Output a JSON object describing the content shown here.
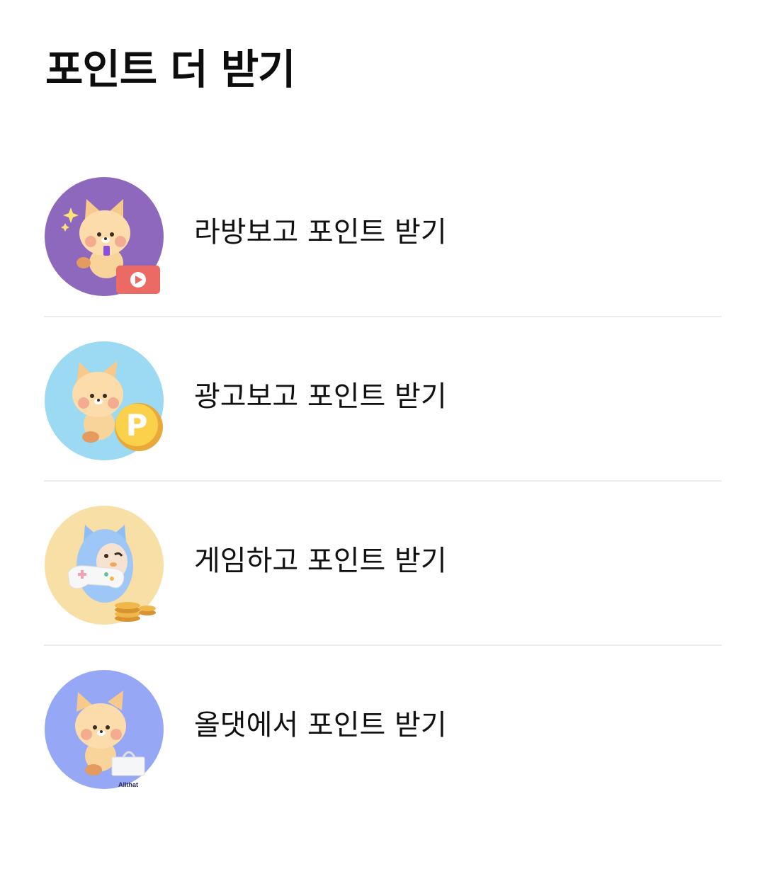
{
  "section": {
    "title": "포인트 더 받기"
  },
  "items": [
    {
      "label": "라방보고 포인트 받기",
      "icon": "live-video-icon",
      "bg_color": "#8e68bd"
    },
    {
      "label": "광고보고 포인트 받기",
      "icon": "point-coin-icon",
      "bg_color": "#9cd9f2"
    },
    {
      "label": "게임하고 포인트 받기",
      "icon": "game-controller-icon",
      "bg_color": "#f7dfa6"
    },
    {
      "label": "올댓에서 포인트 받기",
      "icon": "allthat-bag-icon",
      "bg_color": "#95a7f5",
      "badge_text": "Allthat"
    }
  ]
}
